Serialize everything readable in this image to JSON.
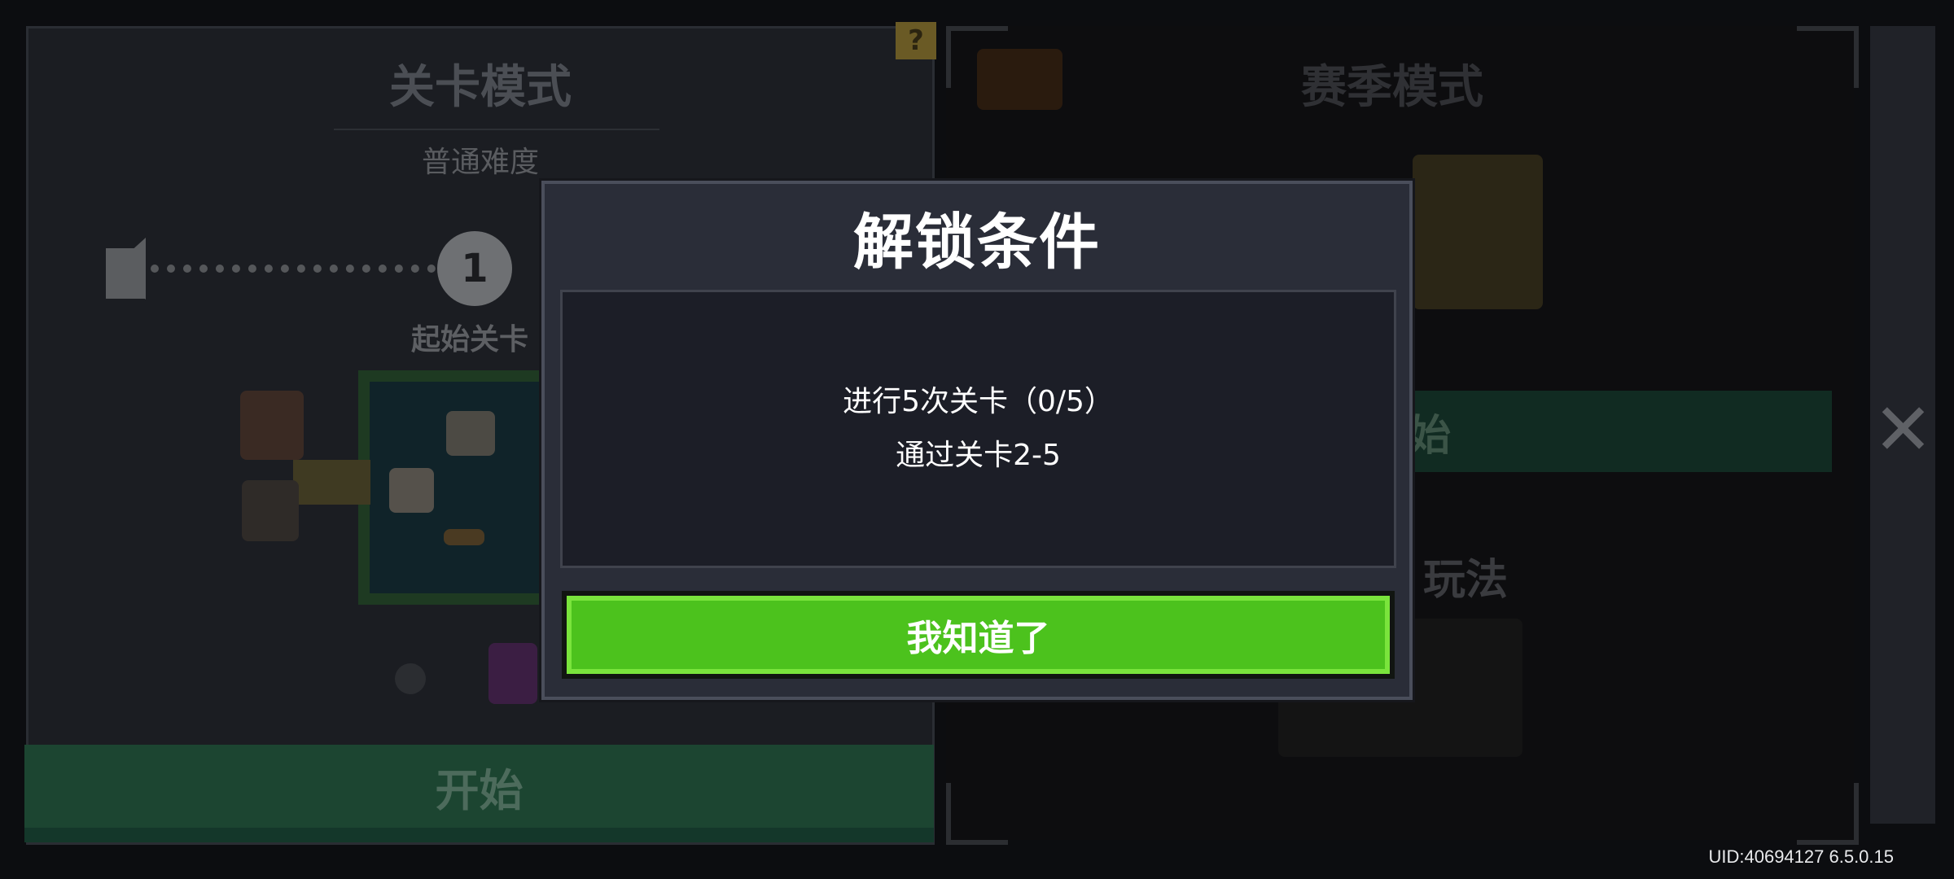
{
  "background": {
    "left_panel": {
      "title": "关卡模式",
      "difficulty": "普通难度",
      "node_number": "1",
      "node_label": "起始关卡",
      "start_button": "开始"
    },
    "right_panel": {
      "title": "赛季模式",
      "start_button_partial": "始",
      "section_title_partial": "玩法"
    },
    "help_icon": "?",
    "close_icon": "✕",
    "uid_text": "UID:40694127 6.5.0.15"
  },
  "modal": {
    "title": "解锁条件",
    "conditions": [
      "进行5次关卡（0/5）",
      "通过关卡2-5"
    ],
    "confirm_button": "我知道了"
  },
  "colors": {
    "confirm_green": "#4cc21d",
    "modal_bg": "#2a2d38",
    "content_bg": "#1c1e27"
  }
}
